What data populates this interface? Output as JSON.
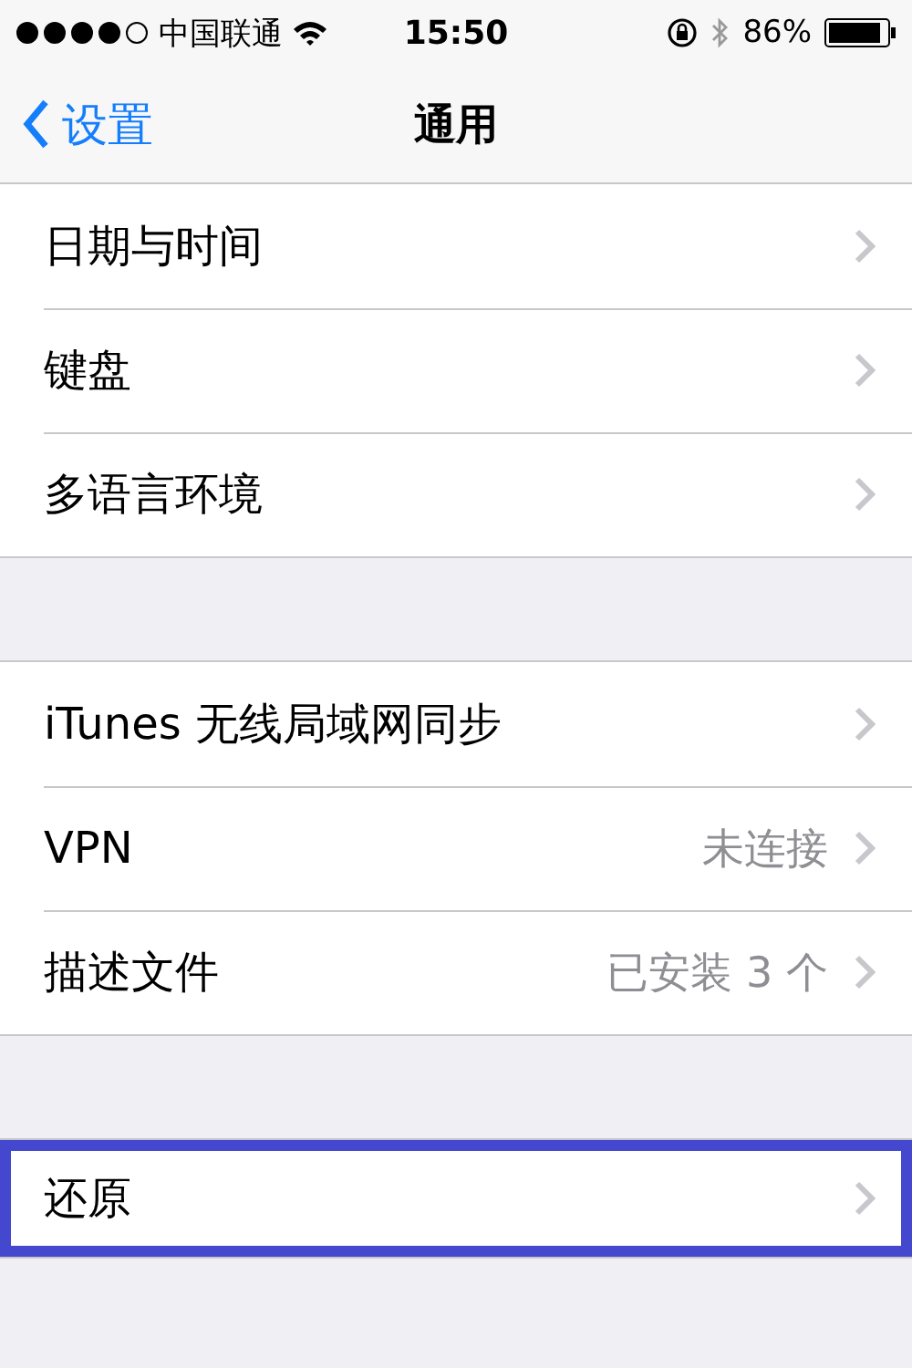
{
  "status_bar": {
    "carrier": "中国联通",
    "time": "15:50",
    "battery": "86%"
  },
  "nav": {
    "back": "设置",
    "title": "通用"
  },
  "sections": [
    {
      "rows": [
        {
          "label": "日期与时间",
          "highlighted": false
        },
        {
          "label": "键盘",
          "highlighted": false
        },
        {
          "label": "多语言环境",
          "highlighted": false
        }
      ]
    },
    {
      "rows": [
        {
          "label": "iTunes 无线局域网同步",
          "highlighted": false
        },
        {
          "label": "VPN",
          "value": "未连接",
          "highlighted": false
        },
        {
          "label": "描述文件",
          "value": "已安装 3 个",
          "highlighted": false
        }
      ]
    },
    {
      "rows": [
        {
          "label": "还原",
          "highlighted": true
        }
      ]
    }
  ]
}
